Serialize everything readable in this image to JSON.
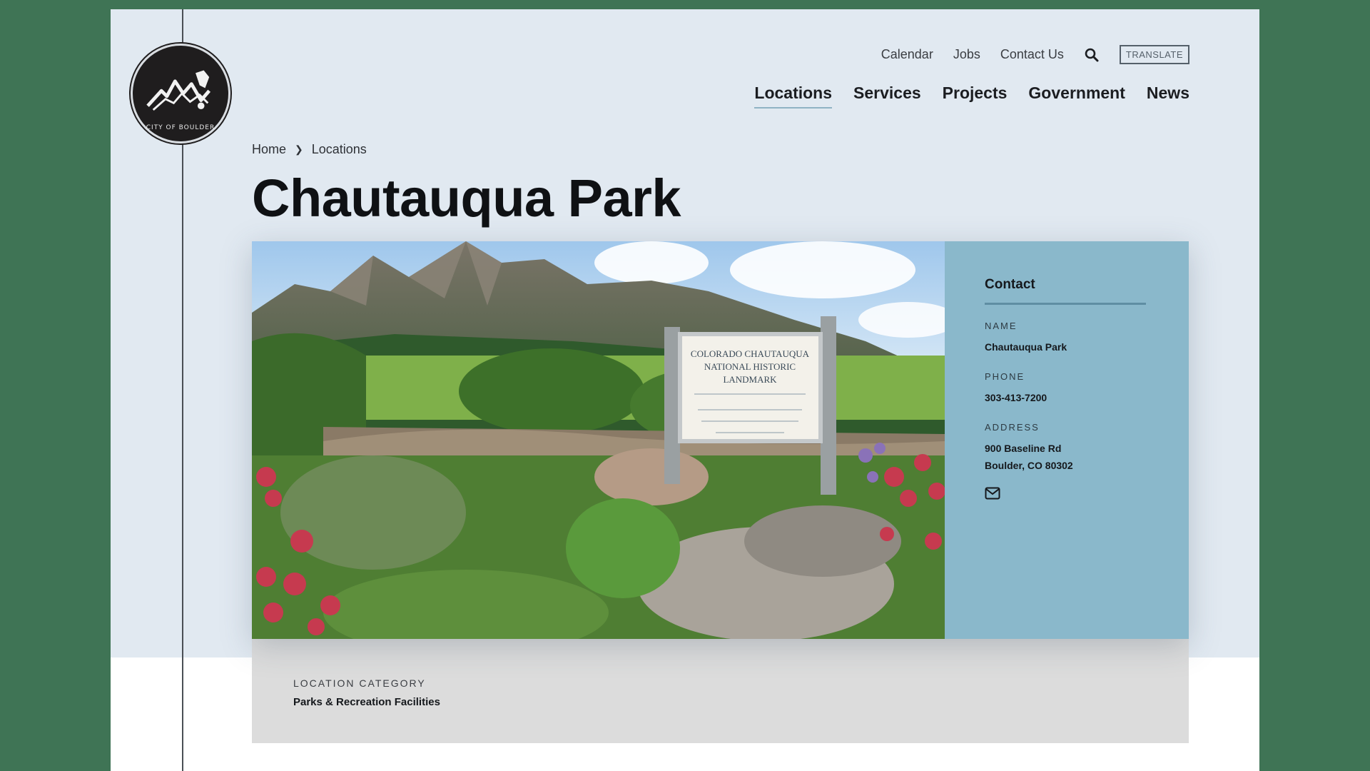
{
  "logo": {
    "alt_text": "CITY OF BOULDER"
  },
  "utility_nav": {
    "calendar": "Calendar",
    "jobs": "Jobs",
    "contact_us": "Contact Us",
    "translate": "TRANSLATE"
  },
  "main_nav": {
    "items": [
      {
        "label": "Locations",
        "active": true
      },
      {
        "label": "Services"
      },
      {
        "label": "Projects"
      },
      {
        "label": "Government"
      },
      {
        "label": "News"
      }
    ]
  },
  "breadcrumb": {
    "home": "Home",
    "current": "Locations"
  },
  "page": {
    "title": "Chautauqua Park"
  },
  "hero_sign": {
    "line1": "COLORADO CHAUTAUQUA",
    "line2": "NATIONAL HISTORIC",
    "line3": "LANDMARK"
  },
  "contact": {
    "heading": "Contact",
    "name_label": "NAME",
    "name_value": "Chautauqua Park",
    "phone_label": "PHONE",
    "phone_value": "303-413-7200",
    "address_label": "ADDRESS",
    "address_line1": "900 Baseline Rd",
    "address_line2": "Boulder, CO 80302"
  },
  "category": {
    "label": "LOCATION CATEGORY",
    "value": "Parks & Recreation Facilities"
  },
  "colors": {
    "background": "#3f7455",
    "page_top": "#e1e9f1",
    "contact_panel": "#8ab8cb",
    "category_bar": "#dcdcdc"
  }
}
